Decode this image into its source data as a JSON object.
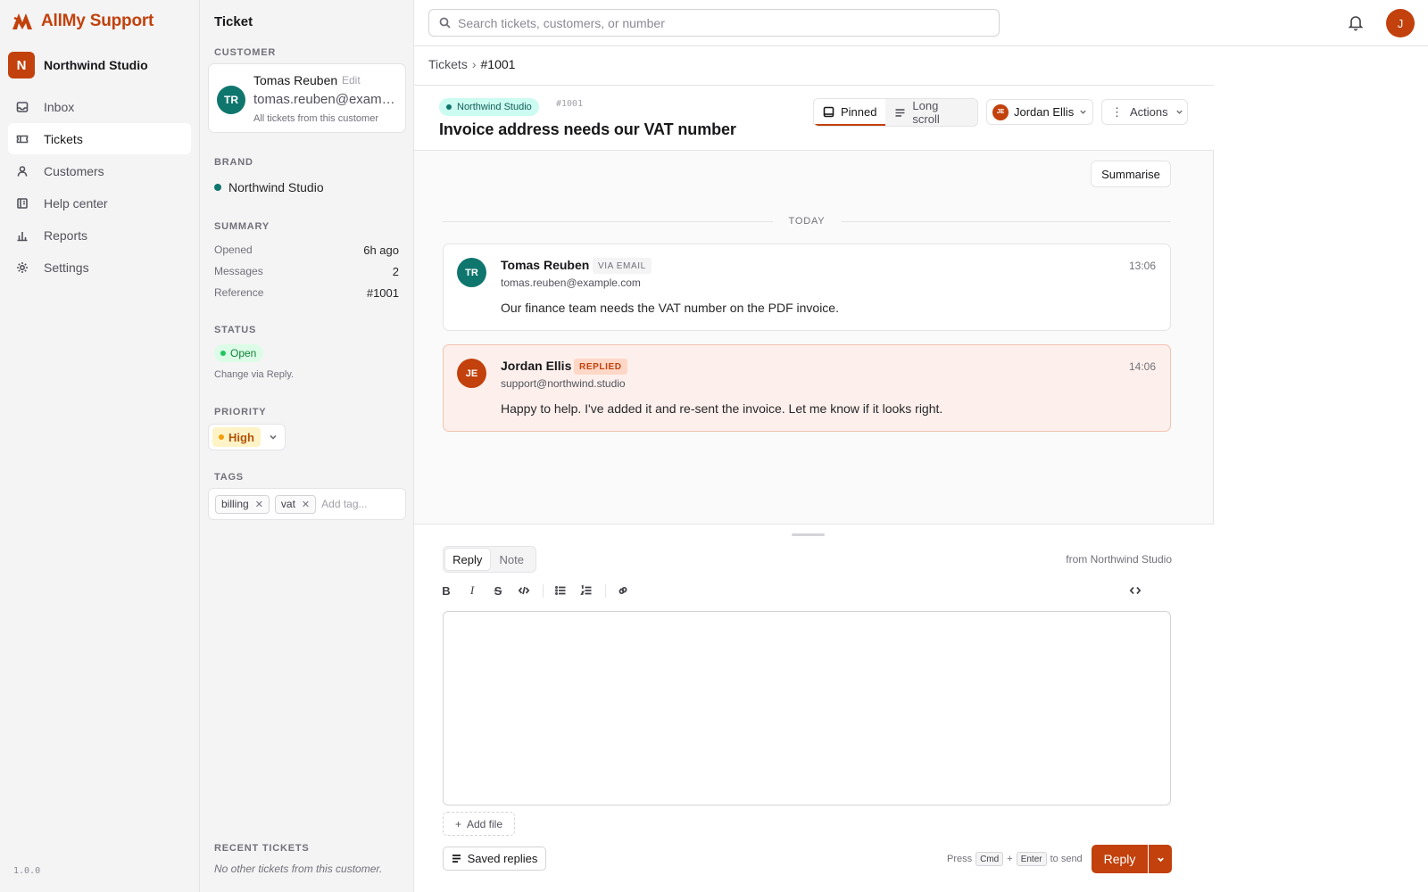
{
  "app": {
    "name": "AllMy Support",
    "version": "1.0.0",
    "accent": "#c2410c"
  },
  "workspace": {
    "initial": "N",
    "name": "Northwind Studio"
  },
  "nav": {
    "items": [
      {
        "label": "Inbox",
        "icon": "inbox-icon"
      },
      {
        "label": "Tickets",
        "icon": "ticket-icon",
        "active": true
      },
      {
        "label": "Customers",
        "icon": "user-icon"
      },
      {
        "label": "Help center",
        "icon": "book-icon"
      },
      {
        "label": "Reports",
        "icon": "bar-chart-icon"
      },
      {
        "label": "Settings",
        "icon": "gear-icon"
      }
    ]
  },
  "side": {
    "title": "Ticket",
    "customer_label": "CUSTOMER",
    "customer": {
      "initials": "TR",
      "name": "Tomas Reuben",
      "edit": "Edit",
      "email": "tomas.reuben@example.com",
      "all_tickets": "All tickets from this customer"
    },
    "brand_label": "BRAND",
    "brand": "Northwind Studio",
    "summary_label": "SUMMARY",
    "summary": [
      {
        "key": "Opened",
        "value": "6h ago"
      },
      {
        "key": "Messages",
        "value": "2"
      },
      {
        "key": "Reference",
        "value": "#1001"
      }
    ],
    "status_label": "STATUS",
    "status": "Open",
    "status_note": "Change via Reply.",
    "priority_label": "PRIORITY",
    "priority": "High",
    "tags_label": "TAGS",
    "tags": [
      "billing",
      "vat"
    ],
    "tag_placeholder": "Add tag...",
    "recent_label": "RECENT TICKETS",
    "recent_empty": "No other tickets from this customer."
  },
  "topbar": {
    "search_placeholder": "Search tickets, customers, or number",
    "user_initial": "J"
  },
  "breadcrumb": {
    "root": "Tickets",
    "sep": "›",
    "current": "#1001"
  },
  "ticket": {
    "brand": "Northwind Studio",
    "number": "#1001",
    "subject": "Invoice address needs our VAT number",
    "view_pinned": "Pinned",
    "view_long": "Long scroll",
    "assignee_initials": "JE",
    "assignee": "Jordan Ellis",
    "actions": "Actions",
    "summarise": "Summarise",
    "day_label": "TODAY"
  },
  "messages": [
    {
      "initials": "TR",
      "author": "Tomas Reuben",
      "badge": "VIA EMAIL",
      "from": "tomas.reuben@example.com",
      "time": "13:06",
      "body": "Our finance team needs the VAT number on the PDF invoice."
    },
    {
      "initials": "JE",
      "author": "Jordan Ellis",
      "badge": "REPLIED",
      "from": "support@northwind.studio",
      "time": "14:06",
      "body": "Happy to help. I've added it and re-sent the invoice. Let me know if it looks right."
    }
  ],
  "composer": {
    "tab_reply": "Reply",
    "tab_note": "Note",
    "from": "from Northwind Studio",
    "add_file": "Add file",
    "saved_replies": "Saved replies",
    "hint_press": "Press",
    "hint_cmd": "Cmd",
    "hint_plus": "+",
    "hint_enter": "Enter",
    "hint_send": "to send",
    "send": "Reply"
  }
}
